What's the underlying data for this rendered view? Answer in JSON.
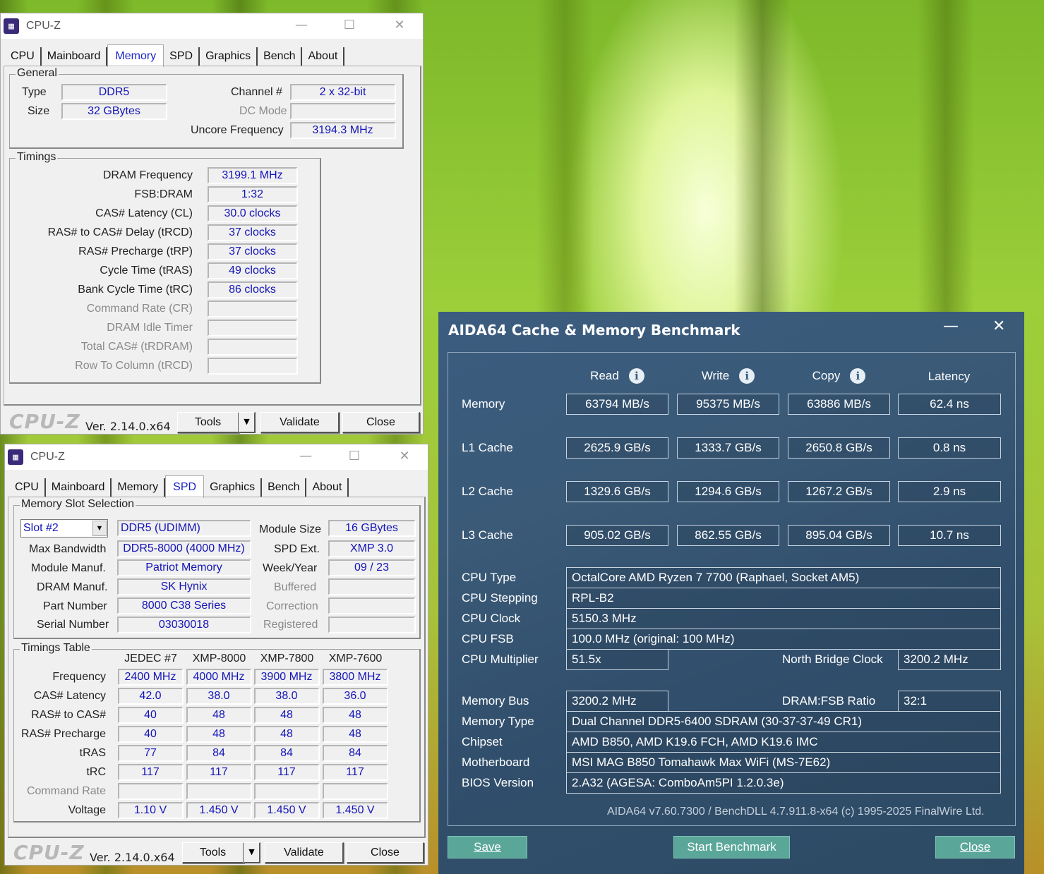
{
  "cpuz_memory": {
    "title": "CPU-Z",
    "tabs": [
      "CPU",
      "Mainboard",
      "Memory",
      "SPD",
      "Graphics",
      "Bench",
      "About"
    ],
    "active_tab": "Memory",
    "general": {
      "legend": "General",
      "type_label": "Type",
      "type": "DDR5",
      "size_label": "Size",
      "size": "32 GBytes",
      "channel_label": "Channel #",
      "channel": "2 x 32-bit",
      "dc_mode_label": "DC Mode",
      "dc_mode": "",
      "uncore_label": "Uncore Frequency",
      "uncore": "3194.3 MHz"
    },
    "timings": {
      "legend": "Timings",
      "rows": [
        {
          "label": "DRAM Frequency",
          "value": "3199.1 MHz",
          "dim": false
        },
        {
          "label": "FSB:DRAM",
          "value": "1:32",
          "dim": false
        },
        {
          "label": "CAS# Latency (CL)",
          "value": "30.0 clocks",
          "dim": false
        },
        {
          "label": "RAS# to CAS# Delay (tRCD)",
          "value": "37 clocks",
          "dim": false
        },
        {
          "label": "RAS# Precharge (tRP)",
          "value": "37 clocks",
          "dim": false
        },
        {
          "label": "Cycle Time (tRAS)",
          "value": "49 clocks",
          "dim": false
        },
        {
          "label": "Bank Cycle Time (tRC)",
          "value": "86 clocks",
          "dim": false
        },
        {
          "label": "Command Rate (CR)",
          "value": "",
          "dim": true
        },
        {
          "label": "DRAM Idle Timer",
          "value": "",
          "dim": true
        },
        {
          "label": "Total CAS# (tRDRAM)",
          "value": "",
          "dim": true
        },
        {
          "label": "Row To Column (tRCD)",
          "value": "",
          "dim": true
        }
      ]
    },
    "logo": "CPU-Z",
    "version": "Ver. 2.14.0.x64",
    "tools": "Tools",
    "validate": "Validate",
    "close": "Close"
  },
  "cpuz_spd": {
    "title": "CPU-Z",
    "tabs": [
      "CPU",
      "Mainboard",
      "Memory",
      "SPD",
      "Graphics",
      "Bench",
      "About"
    ],
    "active_tab": "SPD",
    "slot": {
      "legend": "Memory Slot Selection",
      "selected": "Slot #2",
      "module_type": "DDR5 (UDIMM)",
      "module_size_label": "Module Size",
      "module_size": "16 GBytes",
      "max_bw_label": "Max Bandwidth",
      "max_bw": "DDR5-8000 (4000 MHz)",
      "spd_ext_label": "SPD Ext.",
      "spd_ext": "XMP 3.0",
      "manuf_label": "Module Manuf.",
      "manuf": "Patriot Memory",
      "week_label": "Week/Year",
      "week": "09 / 23",
      "dram_label": "DRAM Manuf.",
      "dram": "SK Hynix",
      "buffered_label": "Buffered",
      "buffered": "",
      "part_label": "Part Number",
      "part": "8000 C38 Series",
      "correction_label": "Correction",
      "correction": "",
      "serial_label": "Serial Number",
      "serial": "03030018",
      "registered_label": "Registered",
      "registered": ""
    },
    "timings_table": {
      "legend": "Timings Table",
      "columns": [
        "JEDEC #7",
        "XMP-8000",
        "XMP-7800",
        "XMP-7600"
      ],
      "rows": [
        {
          "label": "Frequency",
          "dim": false,
          "values": [
            "2400 MHz",
            "4000 MHz",
            "3900 MHz",
            "3800 MHz"
          ]
        },
        {
          "label": "CAS# Latency",
          "dim": false,
          "values": [
            "42.0",
            "38.0",
            "38.0",
            "36.0"
          ]
        },
        {
          "label": "RAS# to CAS#",
          "dim": false,
          "values": [
            "40",
            "48",
            "48",
            "48"
          ]
        },
        {
          "label": "RAS# Precharge",
          "dim": false,
          "values": [
            "40",
            "48",
            "48",
            "48"
          ]
        },
        {
          "label": "tRAS",
          "dim": false,
          "values": [
            "77",
            "84",
            "84",
            "84"
          ]
        },
        {
          "label": "tRC",
          "dim": false,
          "values": [
            "117",
            "117",
            "117",
            "117"
          ]
        },
        {
          "label": "Command Rate",
          "dim": true,
          "values": [
            "",
            "",
            "",
            ""
          ]
        },
        {
          "label": "Voltage",
          "dim": false,
          "values": [
            "1.10 V",
            "1.450 V",
            "1.450 V",
            "1.450 V"
          ]
        }
      ]
    },
    "logo": "CPU-Z",
    "version": "Ver. 2.14.0.x64",
    "tools": "Tools",
    "validate": "Validate",
    "close": "Close"
  },
  "aida": {
    "title": "AIDA64 Cache & Memory Benchmark",
    "headers": [
      "Read",
      "Write",
      "Copy",
      "Latency"
    ],
    "bench_rows": [
      {
        "label": "Memory",
        "values": [
          "63794 MB/s",
          "95375 MB/s",
          "63886 MB/s",
          "62.4 ns"
        ]
      },
      {
        "label": "L1 Cache",
        "values": [
          "2625.9 GB/s",
          "1333.7 GB/s",
          "2650.8 GB/s",
          "0.8 ns"
        ]
      },
      {
        "label": "L2 Cache",
        "values": [
          "1329.6 GB/s",
          "1294.6 GB/s",
          "1267.2 GB/s",
          "2.9 ns"
        ]
      },
      {
        "label": "L3 Cache",
        "values": [
          "905.02 GB/s",
          "862.55 GB/s",
          "895.04 GB/s",
          "10.7 ns"
        ]
      }
    ],
    "cpu_type_label": "CPU Type",
    "cpu_type": "OctalCore AMD Ryzen 7 7700  (Raphael, Socket AM5)",
    "cpu_stepping_label": "CPU Stepping",
    "cpu_stepping": "RPL-B2",
    "cpu_clock_label": "CPU Clock",
    "cpu_clock": "5150.3 MHz",
    "cpu_fsb_label": "CPU FSB",
    "cpu_fsb": "100.0 MHz  (original: 100 MHz)",
    "cpu_mult_label": "CPU Multiplier",
    "cpu_mult": "51.5x",
    "nb_clock_label": "North Bridge Clock",
    "nb_clock": "3200.2 MHz",
    "mem_bus_label": "Memory Bus",
    "mem_bus": "3200.2 MHz",
    "dram_fsb_label": "DRAM:FSB Ratio",
    "dram_fsb": "32:1",
    "mem_type_label": "Memory Type",
    "mem_type": "Dual Channel DDR5-6400 SDRAM  (30-37-37-49 CR1)",
    "chipset_label": "Chipset",
    "chipset": "AMD B850, AMD K19.6 FCH, AMD K19.6 IMC",
    "mobo_label": "Motherboard",
    "mobo": "MSI MAG B850 Tomahawk Max WiFi (MS-7E62)",
    "bios_label": "BIOS Version",
    "bios": "2.A32  (AGESA: ComboAm5PI 1.2.0.3e)",
    "footer": "AIDA64 v7.60.7300 / BenchDLL 4.7.911.8-x64  (c) 1995-2025 FinalWire Ltd.",
    "save": "Save",
    "start": "Start Benchmark",
    "close": "Close"
  }
}
